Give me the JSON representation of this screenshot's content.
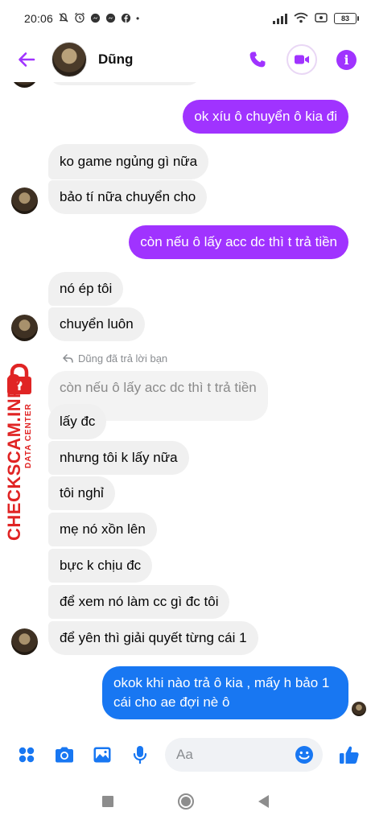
{
  "status_bar": {
    "time": "20:06",
    "battery": "83"
  },
  "header": {
    "contact_name": "Dũng",
    "accent_color": "#a033ff"
  },
  "messages": [
    {
      "side": "out",
      "text": "ok xíu ô chuyển ô kia đi"
    },
    {
      "side": "in",
      "text": "ko game ngủng gì nữa"
    },
    {
      "side": "in",
      "text": "bảo tí nữa chuyển cho"
    },
    {
      "side": "out",
      "text": "còn nếu ô lấy acc dc thì t trả tiền"
    },
    {
      "side": "in",
      "text": "nó ép tôi"
    },
    {
      "side": "in",
      "text": "chuyển luôn"
    },
    {
      "side": "reply_label",
      "text": "Dũng đã trả lời bạn"
    },
    {
      "side": "quoted",
      "text": "còn nếu ô lấy acc dc thì t trả tiền"
    },
    {
      "side": "in",
      "text": "lấy đc"
    },
    {
      "side": "in",
      "text": "nhưng tôi k lấy nữa"
    },
    {
      "side": "in",
      "text": "tôi nghỉ"
    },
    {
      "side": "in",
      "text": "mẹ nó xồn lên"
    },
    {
      "side": "in",
      "text": "bực k chịu đc"
    },
    {
      "side": "in",
      "text": "để xem nó làm cc gì đc tôi"
    },
    {
      "side": "in",
      "text": "để yên thì giải quyết từng cái 1"
    },
    {
      "side": "out_blue",
      "text": "okok khi nào trả ô kia , mấy h bảo 1 cái cho ae đợi nè ô"
    }
  ],
  "watermark": {
    "main": "CHECKSCAM.INFO",
    "sub": "DATA CENTER"
  },
  "composer": {
    "placeholder": "Aa"
  },
  "colors": {
    "outgoing": "#a033ff",
    "outgoing_latest": "#1877f2",
    "incoming": "#f0f0f0",
    "composer_icons": "#1877f2",
    "watermark": "#e02424"
  },
  "icons": {
    "back": "arrow-left-icon",
    "call": "phone-icon",
    "video": "video-camera-icon",
    "info": "info-icon",
    "apps": "four-dots-icon",
    "camera": "camera-icon",
    "gallery": "image-icon",
    "mic": "microphone-icon",
    "emoji": "smiley-icon",
    "like": "thumbs-up-icon"
  }
}
